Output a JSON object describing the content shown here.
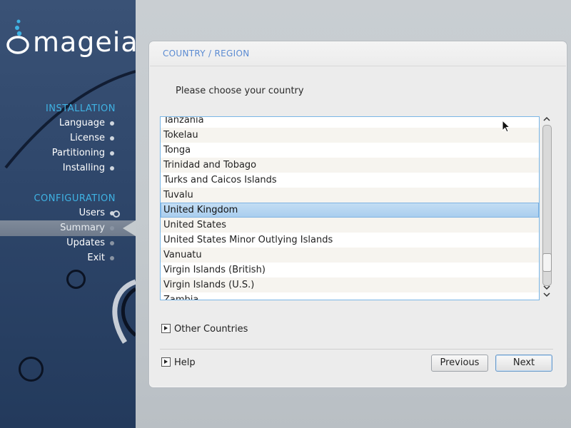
{
  "sidebar": {
    "logo_text": "mageia",
    "sections": [
      {
        "title": "INSTALLATION",
        "items": [
          {
            "label": "Language",
            "state": "done"
          },
          {
            "label": "License",
            "state": "done"
          },
          {
            "label": "Partitioning",
            "state": "done"
          },
          {
            "label": "Installing",
            "state": "done"
          }
        ]
      },
      {
        "title": "CONFIGURATION",
        "items": [
          {
            "label": "Users",
            "state": "done"
          },
          {
            "label": "Summary",
            "state": "current"
          },
          {
            "label": "Updates",
            "state": "pending"
          },
          {
            "label": "Exit",
            "state": "pending"
          }
        ]
      }
    ]
  },
  "panel": {
    "title": "COUNTRY / REGION",
    "prompt": "Please choose your country",
    "countries": [
      "Tanzania",
      "Tokelau",
      "Tonga",
      "Trinidad and Tobago",
      "Turks and Caicos Islands",
      "Tuvalu",
      "United Kingdom",
      "United States",
      "United States Minor Outlying Islands",
      "Vanuatu",
      "Virgin Islands (British)",
      "Virgin Islands (U.S.)",
      "Zambia"
    ],
    "selected_country": "United Kingdom",
    "other_countries_label": "Other Countries",
    "help_label": "Help",
    "previous_label": "Previous",
    "next_label": "Next"
  },
  "colors": {
    "accent": "#3fb3e4",
    "panel_title": "#5b8bd2",
    "selection": "#a9cdee",
    "sidebar_bg": "#2e466a"
  },
  "icons": {
    "scroll_up": "chevron-up-icon",
    "scroll_down": "chevron-down-icon",
    "expander": "triangle-right-icon",
    "cursor": "mouse-pointer-icon"
  }
}
